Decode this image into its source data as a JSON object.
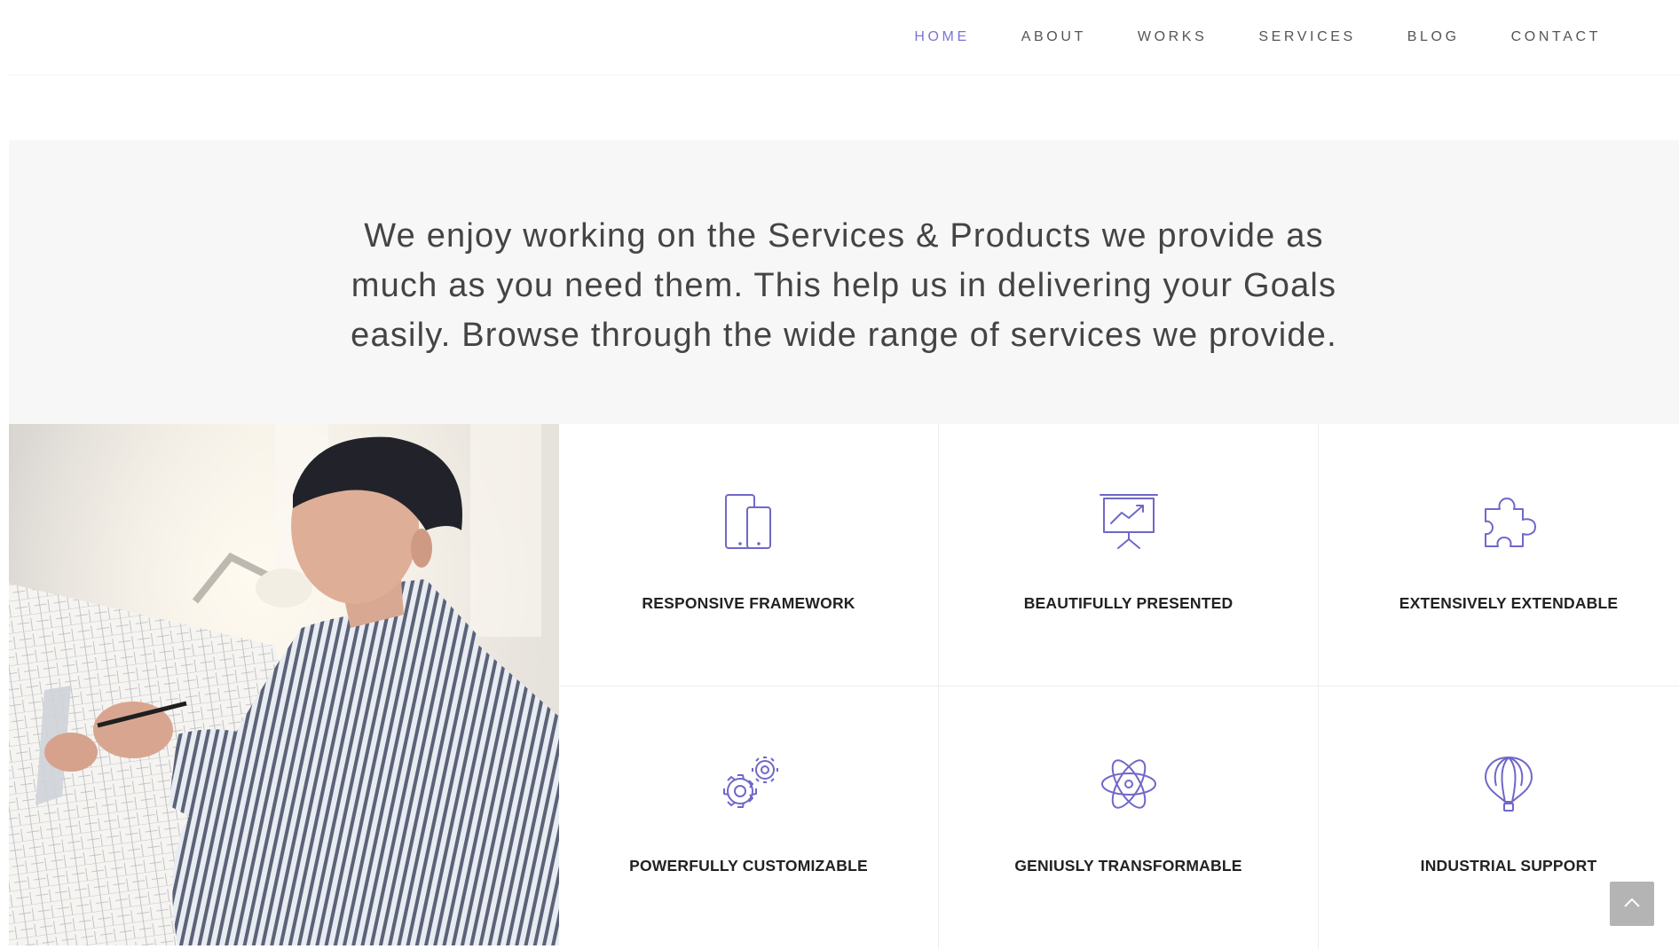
{
  "nav": {
    "items": [
      {
        "label": "HOME",
        "active": true
      },
      {
        "label": "ABOUT",
        "active": false
      },
      {
        "label": "WORKS",
        "active": false
      },
      {
        "label": "SERVICES",
        "active": false
      },
      {
        "label": "BLOG",
        "active": false
      },
      {
        "label": "CONTACT",
        "active": false
      }
    ],
    "active_color": "#7b74d0"
  },
  "intro": {
    "text": "We enjoy working on the Services & Products we provide as much as you need them. This help us in delivering your Goals easily. Browse through the wide range of services we provide."
  },
  "photo": {
    "subject": "architect-drawing-blueprint"
  },
  "features": {
    "icon_color": "#6f68c9",
    "items": [
      {
        "title": "RESPONSIVE FRAMEWORK",
        "icon": "devices-icon"
      },
      {
        "title": "BEAUTIFULLY PRESENTED",
        "icon": "presentation-icon"
      },
      {
        "title": "EXTENSIVELY EXTENDABLE",
        "icon": "puzzle-icon"
      },
      {
        "title": "POWERFULLY CUSTOMIZABLE",
        "icon": "gears-icon"
      },
      {
        "title": "GENIUSLY TRANSFORMABLE",
        "icon": "atom-icon"
      },
      {
        "title": "INDUSTRIAL SUPPORT",
        "icon": "balloon-icon"
      }
    ]
  },
  "scroll_top": {
    "icon": "chevron-up-icon"
  }
}
